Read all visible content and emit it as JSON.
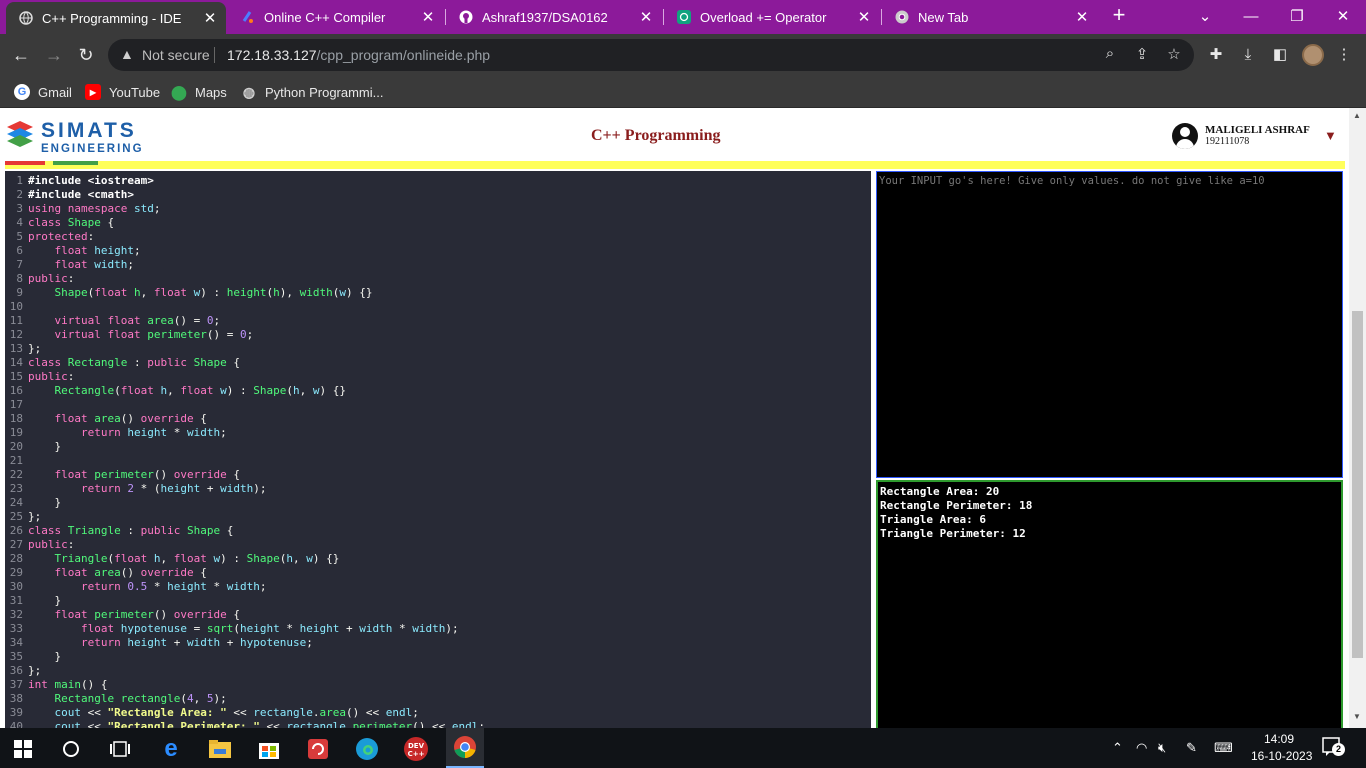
{
  "browser": {
    "tabs": [
      {
        "title": "C++ Programming - IDE",
        "icon": "globe-icon"
      },
      {
        "title": "Online C++ Compiler",
        "icon": "programiz-icon"
      },
      {
        "title": "Ashraf1937/DSA0162",
        "icon": "github-icon"
      },
      {
        "title": "Overload += Operator",
        "icon": "chatgpt-icon"
      },
      {
        "title": "New Tab",
        "icon": "chrome-icon"
      }
    ],
    "address": {
      "security_label": "Not secure",
      "host": "172.18.33.127",
      "path": "/cpp_program/onlineide.php"
    },
    "bookmarks": [
      "Gmail",
      "YouTube",
      "Maps",
      "Python Programmi..."
    ]
  },
  "header": {
    "logo_top": "SIMATS",
    "logo_bottom": "ENGINEERING",
    "title": "C++ Programming",
    "user_name": "MALIGELI ASHRAF",
    "user_id": "192111078"
  },
  "editor": {
    "lines": [
      "#include <iostream>",
      "#include <cmath>",
      "using namespace std;",
      "class Shape {",
      "protected:",
      "    float height;",
      "    float width;",
      "public:",
      "    Shape(float h, float w) : height(h), width(w) {}",
      "",
      "    virtual float area() = 0;",
      "    virtual float perimeter() = 0;",
      "};",
      "class Rectangle : public Shape {",
      "public:",
      "    Rectangle(float h, float w) : Shape(h, w) {}",
      "",
      "    float area() override {",
      "        return height * width;",
      "    }",
      "",
      "    float perimeter() override {",
      "        return 2 * (height + width);",
      "    }",
      "};",
      "class Triangle : public Shape {",
      "public:",
      "    Triangle(float h, float w) : Shape(h, w) {}",
      "    float area() override {",
      "        return 0.5 * height * width;",
      "    }",
      "    float perimeter() override {",
      "        float hypotenuse = sqrt(height * height + width * width);",
      "        return height + width + hypotenuse;",
      "    }",
      "};",
      "int main() {",
      "    Rectangle rectangle(4, 5);",
      "    cout << \"Rectangle Area: \" << rectangle.area() << endl;",
      "    cout << \"Rectangle Perimeter: \" << rectangle.perimeter() << endl;"
    ]
  },
  "input_panel": {
    "placeholder": "Your INPUT go's here! Give only values. do not give like a=10"
  },
  "output_panel": {
    "lines": [
      "Rectangle Area: 20",
      "Rectangle Perimeter: 18",
      "Triangle Area: 6",
      "Triangle Perimeter: 12"
    ]
  },
  "taskbar": {
    "time": "14:09",
    "date": "16-10-2023",
    "notifications": "2"
  },
  "colors": {
    "tab_strip": "#8c1a9a",
    "editor_bg": "#282a36",
    "title_maroon": "#8a1d1d",
    "input_border": "#2f58ff",
    "output_border": "#2e9a2e"
  }
}
